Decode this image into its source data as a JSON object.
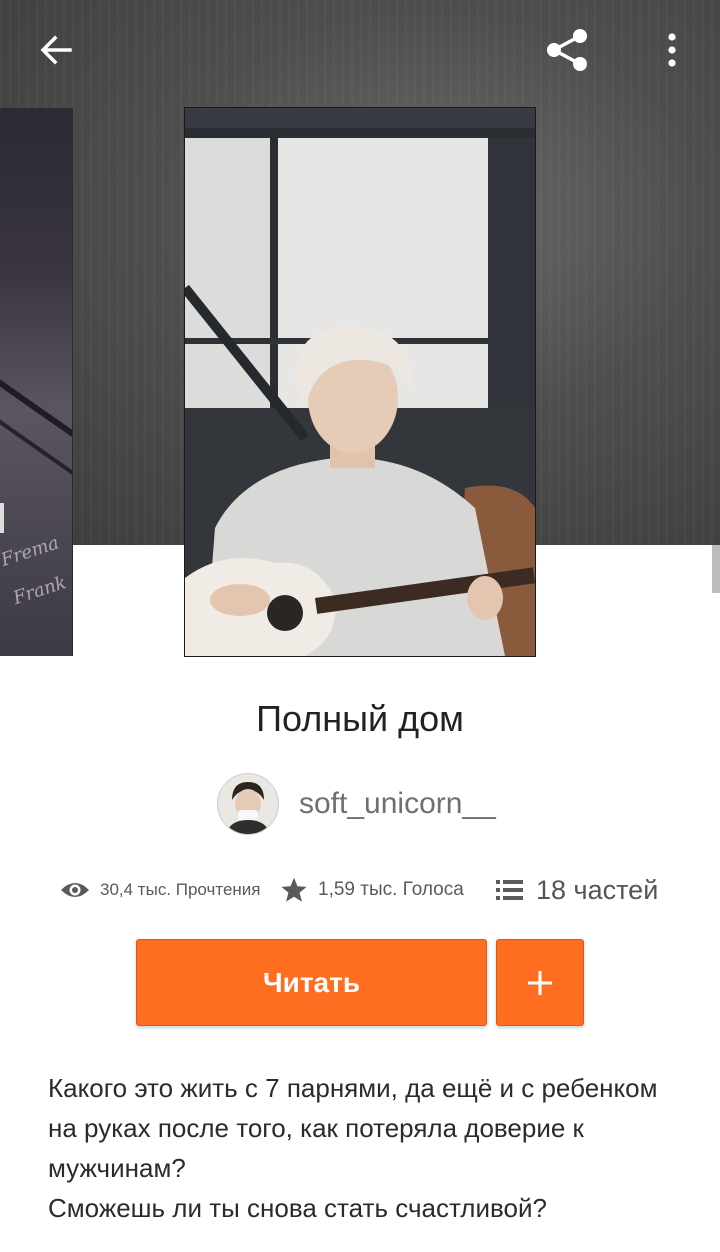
{
  "colors": {
    "accent": "#ff6d21",
    "hero_bg": "#4e4e4e",
    "text": "#222222",
    "muted": "#6f6f6f"
  },
  "topbar": {
    "back_icon": "arrow-left-icon",
    "share_icon": "share-icon",
    "more_icon": "more-vertical-icon"
  },
  "prev_cover": {
    "script_text": "Frema\nFrank"
  },
  "story": {
    "title": "Полный дом",
    "author": "soft_unicorn__",
    "stats": {
      "reads": "30,4 тыс. Прочтения",
      "votes": "1,59 тыс. Голоса",
      "parts": "18 частей"
    },
    "read_button": "Читать",
    "add_button": "+",
    "description": [
      "Какого это жить с 7 парнями, да ещё и с ребенком на руках после того, как потеряла доверие к мужчинам?",
      "Сможешь ли ты снова стать счастливой?"
    ]
  }
}
